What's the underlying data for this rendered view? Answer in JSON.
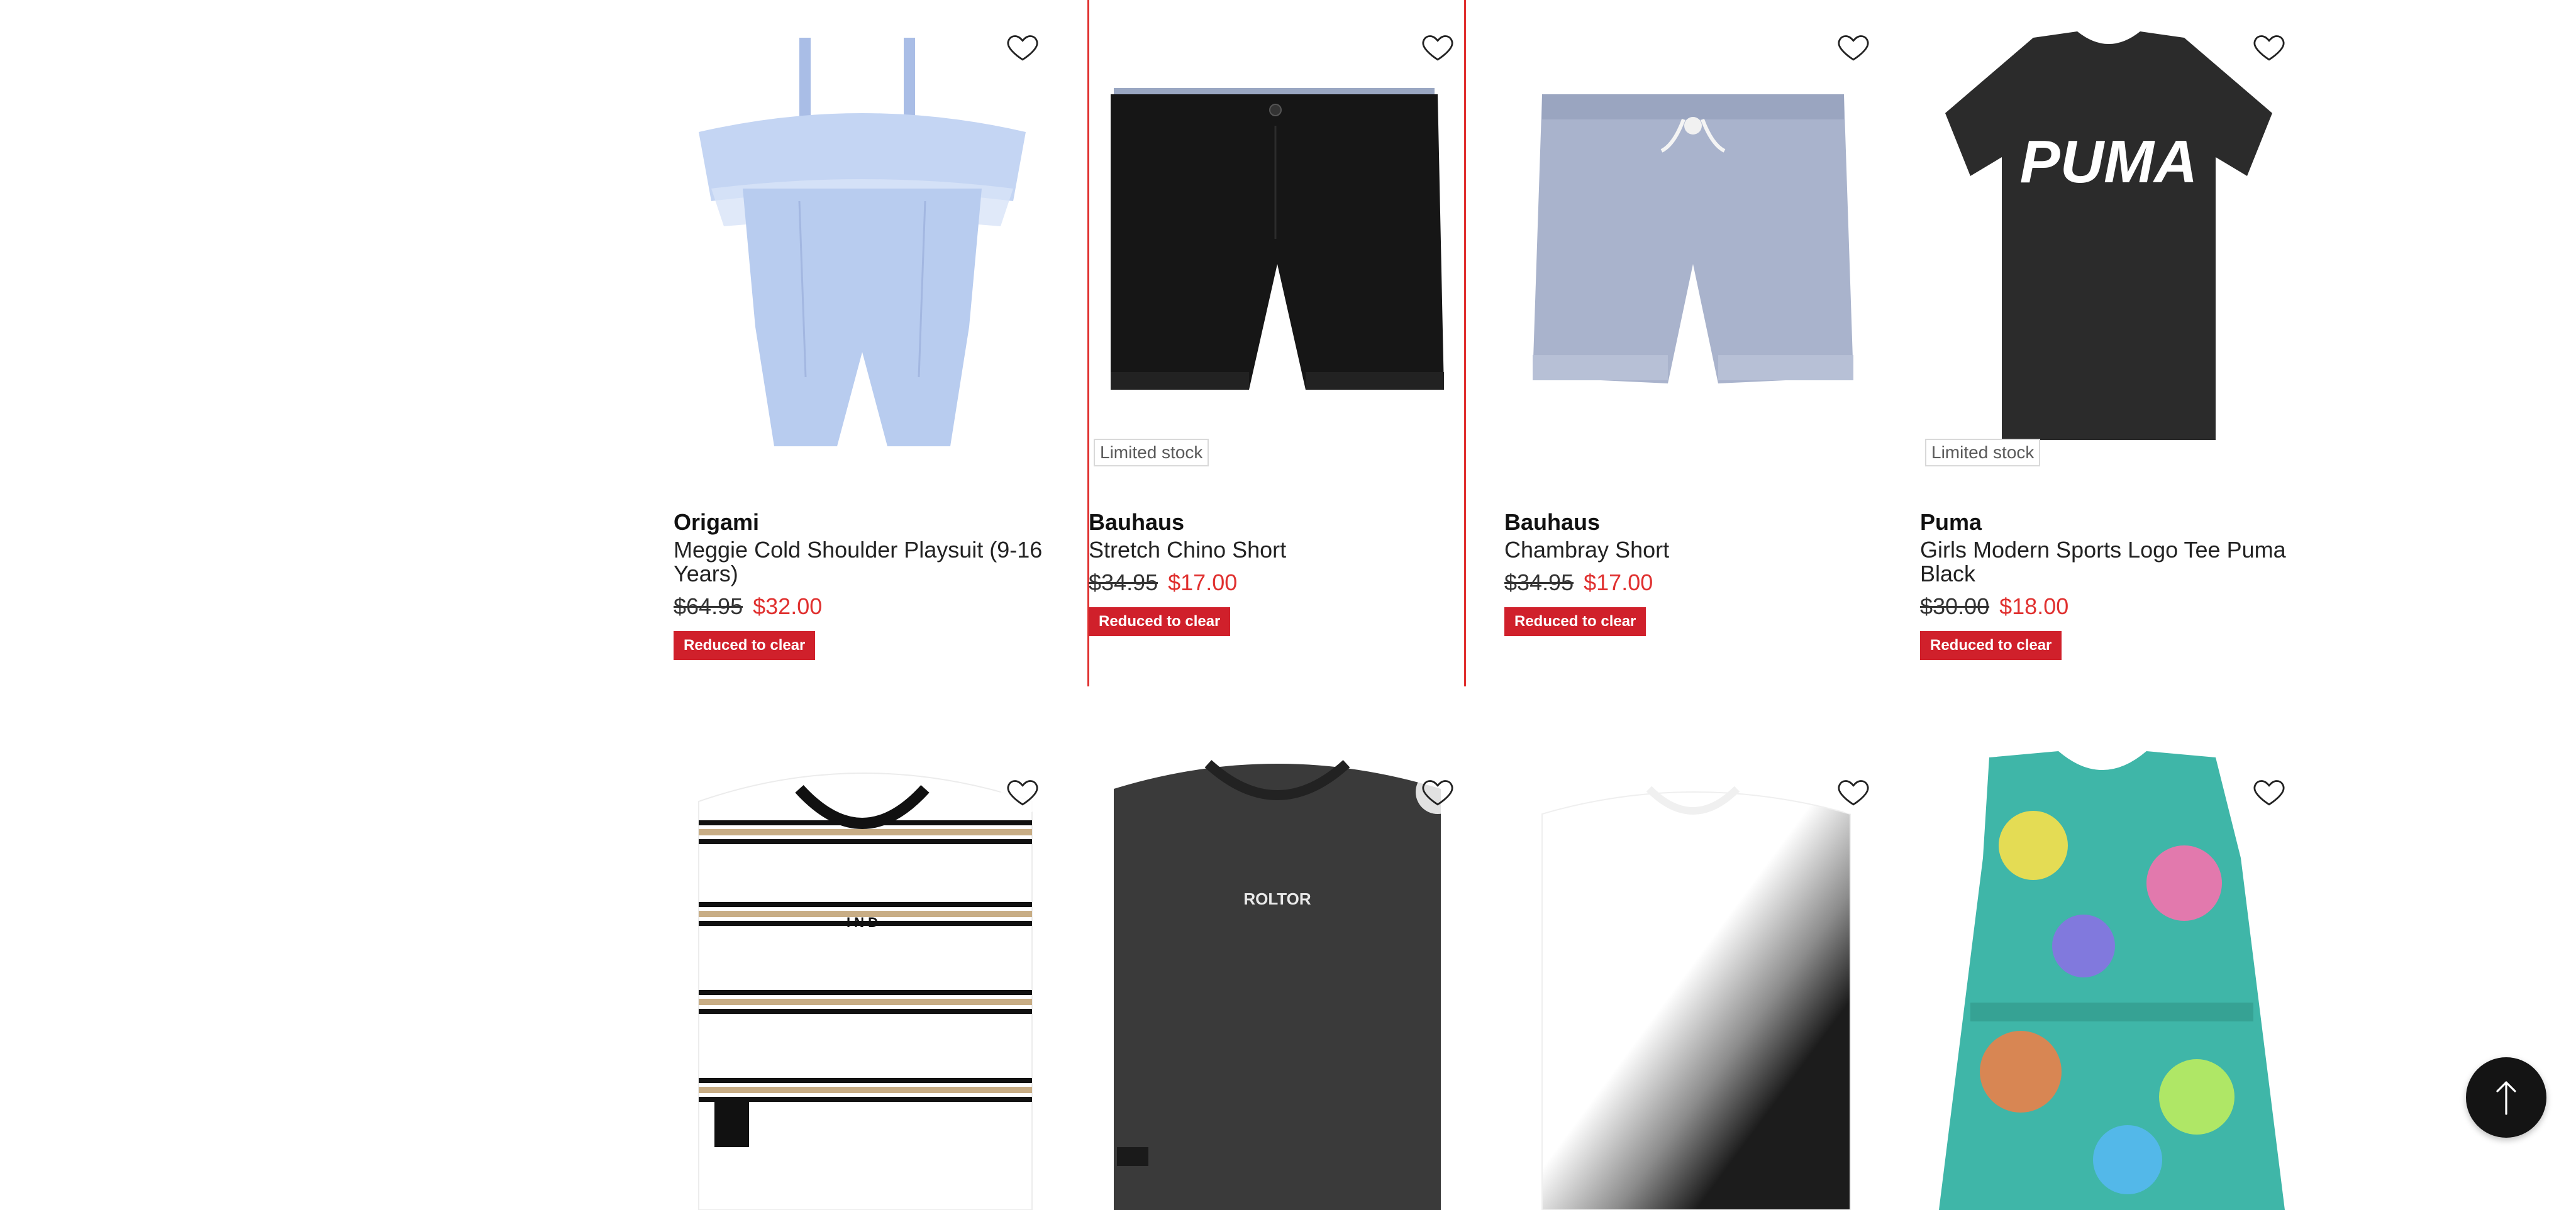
{
  "products": [
    {
      "brand": "Origami",
      "name": "Meggie Cold Shoulder Playsuit (9-16 Years)",
      "price_was": "$64.95",
      "price_now": "$32.00",
      "badge": "Reduced to clear",
      "stock_label": "",
      "image_icon": "playsuit-image",
      "image_color": "#b8ccef"
    },
    {
      "brand": "Bauhaus",
      "name": "Stretch Chino Short",
      "price_was": "$34.95",
      "price_now": "$17.00",
      "badge": "Reduced to clear",
      "stock_label": "Limited stock",
      "image_icon": "shorts-image",
      "image_color": "#161616"
    },
    {
      "brand": "Bauhaus",
      "name": "Chambray Short",
      "price_was": "$34.95",
      "price_now": "$17.00",
      "badge": "Reduced to clear",
      "stock_label": "",
      "image_icon": "shorts-image",
      "image_color": "#a9b3cc"
    },
    {
      "brand": "Puma",
      "name": "Girls Modern Sports Logo Tee Puma Black",
      "price_was": "$30.00",
      "price_now": "$18.00",
      "badge": "Reduced to clear",
      "stock_label": "Limited stock",
      "image_icon": "tshirt-image",
      "image_color": "#2b2b2b",
      "image_text": "PUMA"
    },
    {
      "brand": "",
      "name": "",
      "image_icon": "striped-tank-image",
      "image_color": "#ffffff",
      "image_text": "I N D"
    },
    {
      "brand": "",
      "name": "",
      "image_icon": "tank-image",
      "image_color": "#3a3a3a",
      "image_text": "ROLTOR"
    },
    {
      "brand": "",
      "name": "",
      "image_icon": "tie-dye-tank-image",
      "image_color": "#1c1c1c"
    },
    {
      "brand": "",
      "name": "",
      "image_icon": "floral-playsuit-image",
      "image_color": "#3fb6a8"
    }
  ],
  "ui": {
    "wishlist_icon": "heart-outline-icon",
    "back_to_top_icon": "arrow-up-icon",
    "accent_color": "#e0302f",
    "badge_color": "#d0202b"
  }
}
